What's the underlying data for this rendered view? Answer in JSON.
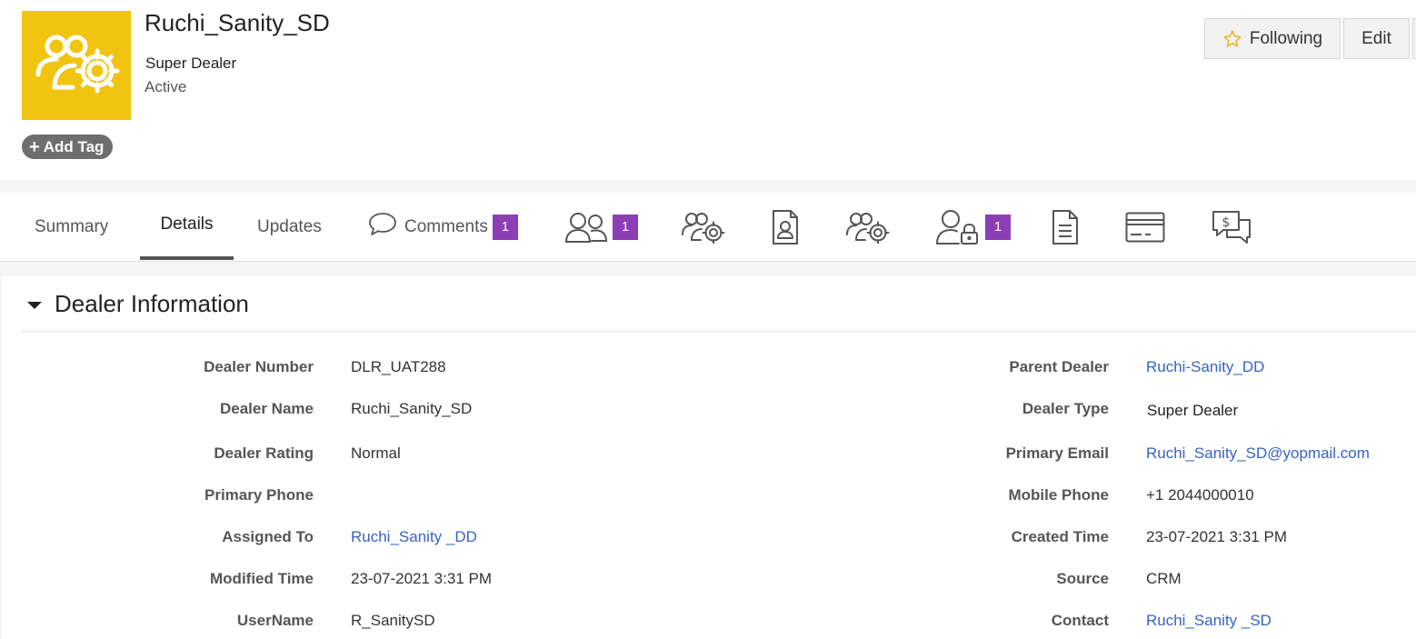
{
  "record": {
    "title": "Ruchi_Sanity_SD",
    "subtitle": "Super Dealer",
    "status": "Active",
    "avatar_icon": "users-gear-icon",
    "avatar_color": "#f0c40f",
    "add_tag_label": "Add Tag"
  },
  "actions": {
    "following_label": "Following",
    "edit_label": "Edit"
  },
  "tabs": [
    {
      "label": "Summary"
    },
    {
      "label": "Details",
      "active": true
    },
    {
      "label": "Updates"
    },
    {
      "label": "Comments",
      "badge": "1",
      "icon": "comment-icon"
    },
    {
      "icon": "users-icon",
      "badge": "1"
    },
    {
      "icon": "users-gear-icon"
    },
    {
      "icon": "contact-card-icon"
    },
    {
      "icon": "users-gear-icon"
    },
    {
      "icon": "user-lock-icon",
      "badge": "1"
    },
    {
      "icon": "document-icon"
    },
    {
      "icon": "credit-card-icon"
    },
    {
      "icon": "dollar-chat-icon"
    }
  ],
  "section": {
    "title": "Dealer Information"
  },
  "fields_left": [
    {
      "label": "Dealer Number",
      "value": "DLR_UAT288"
    },
    {
      "label": "Dealer Name",
      "value": "Ruchi_Sanity_SD"
    },
    {
      "label": "Dealer Rating",
      "value": "Normal"
    },
    {
      "label": "Primary Phone",
      "value": ""
    },
    {
      "label": "Assigned To",
      "value": "Ruchi_Sanity _DD",
      "link": true
    },
    {
      "label": "Modified Time",
      "value": "23-07-2021 3:31 PM"
    },
    {
      "label": "UserName",
      "value": "R_SanitySD"
    }
  ],
  "fields_right": [
    {
      "label": "Parent Dealer",
      "value": "Ruchi-Sanity_DD",
      "link": true
    },
    {
      "label": "Dealer Type",
      "value": "Super Dealer"
    },
    {
      "label": "Primary Email",
      "value": "Ruchi_Sanity_SD@yopmail.com",
      "link": true
    },
    {
      "label": "Mobile Phone",
      "value": "+1 2044000010"
    },
    {
      "label": "Created Time",
      "value": "23-07-2021 3:31 PM"
    },
    {
      "label": "Source",
      "value": "CRM"
    },
    {
      "label": "Contact",
      "value": "Ruchi_Sanity _SD",
      "link": true
    }
  ],
  "colors": {
    "badge": "#8c3fb4",
    "link": "#3862c4",
    "star": "#f0b429"
  }
}
